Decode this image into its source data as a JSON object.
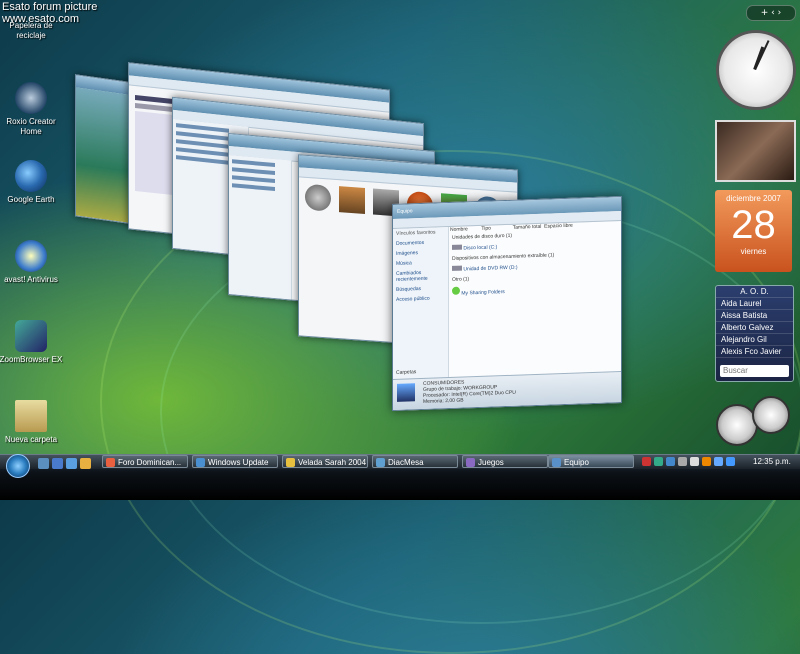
{
  "watermark": {
    "line1": "Esato forum picture",
    "line2": "www.esato.com"
  },
  "desktop_icons": [
    {
      "label": "Papelera de reciclaje",
      "icon": "recycle-bin-icon"
    },
    {
      "label": "Roxio Creator Home",
      "icon": "roxio-icon"
    },
    {
      "label": "Google Earth",
      "icon": "google-earth-icon"
    },
    {
      "label": "avast! Antivirus",
      "icon": "avast-icon"
    },
    {
      "label": "ZoomBrowser EX",
      "icon": "zoombrowser-icon"
    },
    {
      "label": "Nueva carpeta",
      "icon": "folder-icon"
    }
  ],
  "explorer": {
    "title": "Equipo",
    "nav_heading": "Vínculos favoritos",
    "nav_items": [
      "Documentos",
      "Imágenes",
      "Música",
      "Cambiados recientemente",
      "Búsquedas",
      "Acceso público"
    ],
    "col_headers": [
      "Nombre",
      "Tipo",
      "Tamaño total",
      "Espacio libre"
    ],
    "groups": [
      {
        "heading": "Unidades de disco duro (1)",
        "items": [
          "Disco local (C:)"
        ]
      },
      {
        "heading": "Dispositivos con almacenamiento extraíble (1)",
        "items": [
          "Unidad de DVD RW (D:)"
        ]
      },
      {
        "heading": "Otro (1)",
        "items": [
          "My Sharing Folders"
        ]
      }
    ],
    "nav_footer": "Carpetas",
    "status": [
      "CONSUMIDORES",
      "Grupo de trabajo: WORKGROUP",
      "Procesador: Intel(R) Core(TM)2 Duo CPU",
      "Memoria: 2,00 GB"
    ]
  },
  "gadgets": {
    "calendar": {
      "month": "diciembre 2007",
      "day": "28",
      "weekday": "viernes"
    },
    "contacts": {
      "title": "A. O. D.",
      "items": [
        "Aida Laurel",
        "Aissa Batista",
        "Alberto Galvez",
        "Alejandro Gil",
        "Alexis Fco Javier"
      ],
      "search_placeholder": "Buscar"
    },
    "sidebar_controls": "+ ‹ ›"
  },
  "taskbar": {
    "tasks": [
      {
        "label": "Foro Dominican...",
        "active": false
      },
      {
        "label": "Windows Update",
        "active": false
      },
      {
        "label": "Velada Sarah 2004",
        "active": false
      },
      {
        "label": "DiacMesa",
        "active": false
      },
      {
        "label": "Juegos",
        "active": false
      },
      {
        "label": "Equipo",
        "active": true
      }
    ],
    "clock": "12:35 p.m."
  }
}
